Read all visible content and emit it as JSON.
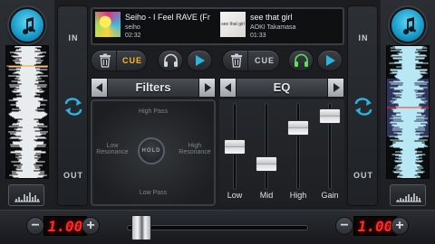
{
  "deckA": {
    "in_label": "IN",
    "out_label": "OUT",
    "track_title": "Seiho - I Feel RAVE  (Fr",
    "track_artist": "seiho",
    "track_time": "02:32",
    "cue_label": "CUE",
    "pitch": "1.00"
  },
  "deckB": {
    "in_label": "IN",
    "out_label": "OUT",
    "track_title": "see that girl",
    "track_artist": "AOKI Takamasa",
    "track_time": "01:33",
    "cue_label": "CUE",
    "art_text": "see that girl",
    "pitch": "1.00"
  },
  "filters": {
    "title": "Filters",
    "high_pass": "High Pass",
    "low_pass": "Low Pass",
    "low_res_1": "Low",
    "low_res_2": "Resonance",
    "high_res_1": "High",
    "high_res_2": "Resonance",
    "hold": "HOLD"
  },
  "eq": {
    "title": "EQ",
    "bands": [
      {
        "label": "Low",
        "level": 0.5
      },
      {
        "label": "Mid",
        "level": 0.3
      },
      {
        "label": "High",
        "level": 0.72
      },
      {
        "label": "Gain",
        "level": 0.85
      }
    ]
  },
  "crossfader": {
    "position": 0.04
  },
  "bottom": {
    "minus": "−",
    "plus": "+"
  },
  "colors": {
    "accent_blue": "#1d9fcc",
    "cue_active": "#ffb51e",
    "cue_inactive": "#c6ccd2",
    "headphone_green": "#5fe05a",
    "pitch_red": "#ff2a2a",
    "playhead_a": "#ff9a1e",
    "playhead_b": "#ff2a2a"
  },
  "icons": {
    "logo": "music-note-icon",
    "sync": "sync-arrows-icon",
    "trash": "trash-icon",
    "headphones": "headphones-icon",
    "play": "play-icon"
  }
}
